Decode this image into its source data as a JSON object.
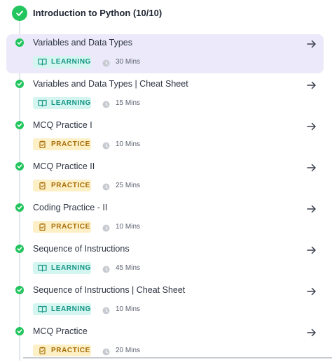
{
  "module": {
    "title": "Introduction to Python (10/10)"
  },
  "items": [
    {
      "title": "Variables and Data Types",
      "type": "LEARNING",
      "duration": "30 Mins",
      "active": true
    },
    {
      "title": "Variables and Data Types | Cheat Sheet",
      "type": "LEARNING",
      "duration": "15 Mins",
      "active": false
    },
    {
      "title": "MCQ Practice I",
      "type": "PRACTICE",
      "duration": "10 Mins",
      "active": false
    },
    {
      "title": "MCQ Practice II",
      "type": "PRACTICE",
      "duration": "25 Mins",
      "active": false
    },
    {
      "title": "Coding Practice - II",
      "type": "PRACTICE",
      "duration": "10 Mins",
      "active": false
    },
    {
      "title": "Sequence of Instructions",
      "type": "LEARNING",
      "duration": "45 Mins",
      "active": false
    },
    {
      "title": "Sequence of Instructions | Cheat Sheet",
      "type": "LEARNING",
      "duration": "10 Mins",
      "active": false
    },
    {
      "title": "MCQ Practice",
      "type": "PRACTICE",
      "duration": "20 Mins",
      "active": false
    }
  ],
  "colors": {
    "check": "#22c55e",
    "active_bg": "#ebe9fa",
    "learning_bg": "#d5f6f0",
    "learning_fg": "#129484",
    "practice_bg": "#fdf0c6",
    "practice_fg": "#a86d08"
  },
  "icons": {
    "complete": "check-circle-icon",
    "learning": "book-icon",
    "practice": "clipboard-icon",
    "duration": "clock-icon",
    "open": "arrow-right-icon"
  }
}
